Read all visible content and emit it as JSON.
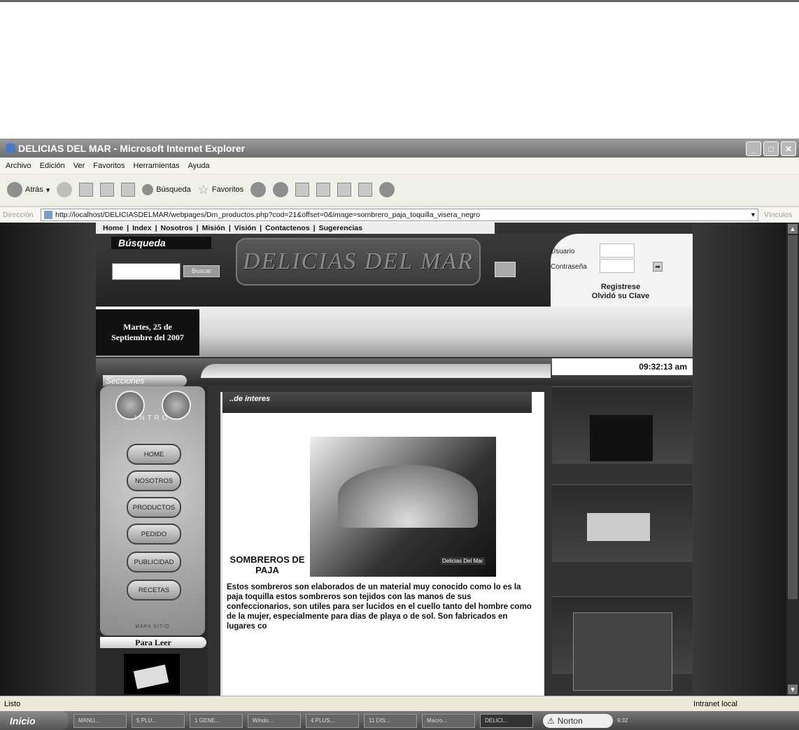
{
  "window": {
    "title": "DELICIAS DEL MAR - Microsoft Internet Explorer"
  },
  "menubar": [
    "Archivo",
    "Edición",
    "Ver",
    "Favoritos",
    "Herramientas",
    "Ayuda"
  ],
  "toolbar": {
    "back": "Atrás",
    "search": "Búsqueda",
    "favorites": "Favoritos"
  },
  "address": {
    "label": "Dirección",
    "url": "http://localhost/DELICIASDELMAR/webpages/Dm_productos.php?cod=21&offset=0&image=sombrero_paja_toquilla_visera_negro",
    "links": "Vínculos"
  },
  "site": {
    "nav": [
      "Home",
      "Index",
      "Nosotros",
      "Misión",
      "Visión",
      "Contactenos",
      "Sugerencias"
    ],
    "search_title": "Búsqueda",
    "search_button": "Buscar",
    "logo": "DELICIAS DEL MAR",
    "login": {
      "user_label": "Usuario",
      "pass_label": "Contraseña",
      "register": "Registrese",
      "forgot": "Olvidó su Clave"
    },
    "date": "Martes, 25 de Septiembre del 2007",
    "clock": "09:32:13 am",
    "sections_label": "Secciones",
    "menu": {
      "intro": "INTRO",
      "items": [
        "HOME",
        "NOSOTROS",
        "PRODUCTOS",
        "PEDIDO",
        "PUBLICIDAD",
        "RECETAS"
      ],
      "map": "MAPA SITIO"
    },
    "para_leer": "Para Leer",
    "content": {
      "title": "..de interes",
      "product_title": "SOMBREROS DE PAJA",
      "photo_caption": "Delicias Del Mar",
      "text": "Estos sombreros son elaborados de un material muy conocido como lo es la paja toquilla estos sombreros son tejidos con las manos de sus confeccionarios, son utiles para ser lucidos en el cuello tanto del hombre como de la mujer, especialmente para dias de playa o de sol. Son fabricados en lugares co"
    }
  },
  "statusbar": {
    "left": "Listo",
    "right": "Intranet local"
  },
  "taskbar": {
    "start": "Inicio",
    "tasks": [
      "MANU...",
      "5 PLU...",
      "1 GENE...",
      "Windo...",
      "4 PLUS...",
      "11 DIS...",
      "Macro...",
      "DELICI..."
    ],
    "norton": "Norton",
    "tray": "9:32"
  }
}
